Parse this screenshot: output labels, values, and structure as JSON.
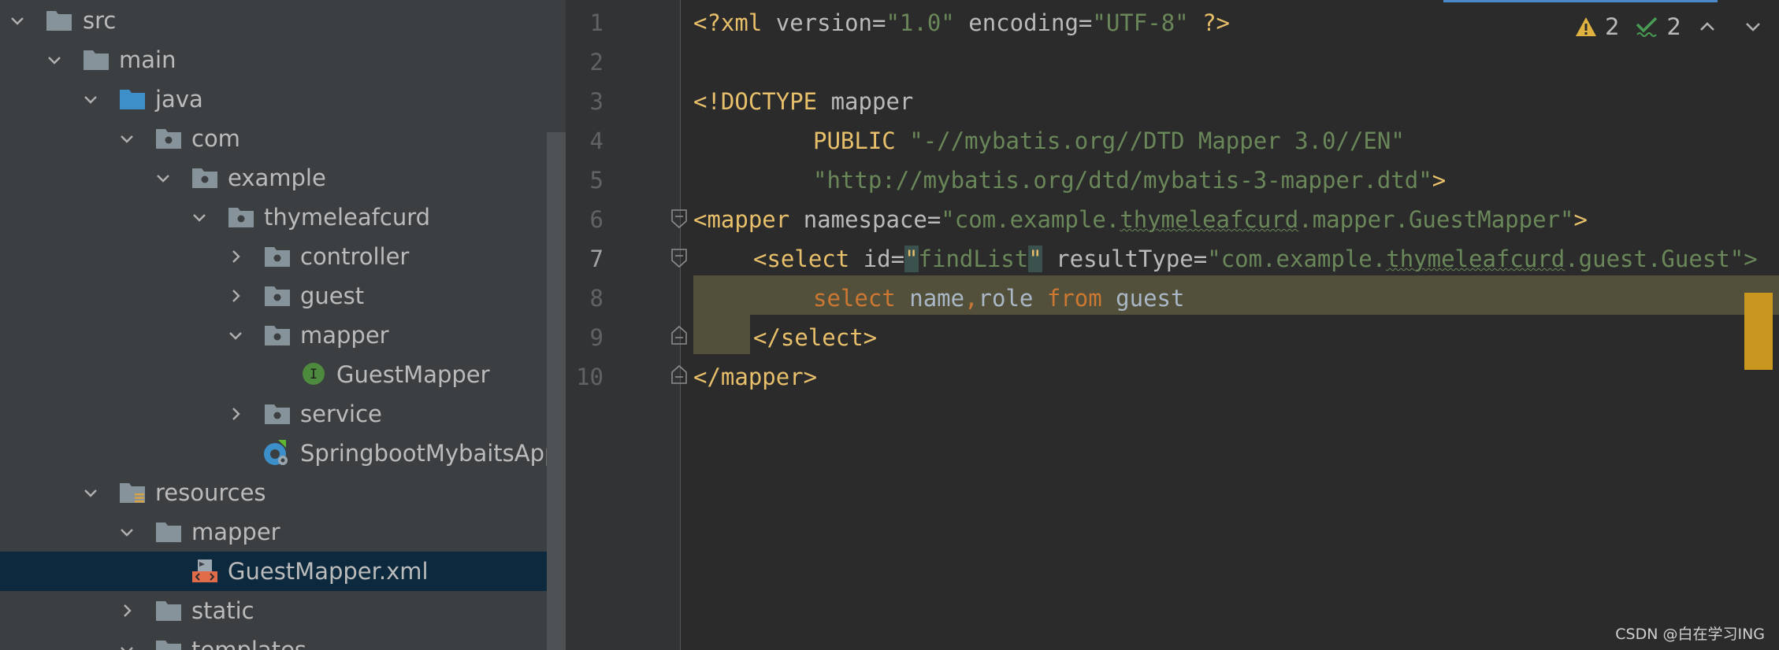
{
  "project_tree": {
    "items": [
      {
        "label": "src",
        "expanded": true
      },
      {
        "label": "main",
        "expanded": true
      },
      {
        "label": "java",
        "expanded": true
      },
      {
        "label": "com",
        "expanded": true
      },
      {
        "label": "example",
        "expanded": true
      },
      {
        "label": "thymeleafcurd",
        "expanded": true
      },
      {
        "label": "controller",
        "expanded": false
      },
      {
        "label": "guest",
        "expanded": false
      },
      {
        "label": "mapper",
        "expanded": true
      },
      {
        "label": "GuestMapper",
        "icon": "interface-icon",
        "icon_letter": "I"
      },
      {
        "label": "service",
        "expanded": false
      },
      {
        "label": "SpringbootMybaitsApplic",
        "icon": "spring-boot-app-icon"
      },
      {
        "label": "resources",
        "expanded": true
      },
      {
        "label": "mapper",
        "expanded": true
      },
      {
        "label": "GuestMapper.xml",
        "icon": "xml-file-icon",
        "selected": true
      },
      {
        "label": "static",
        "expanded": false
      },
      {
        "label": "templates",
        "expanded": true
      }
    ]
  },
  "editor": {
    "line_numbers": [
      "1",
      "2",
      "3",
      "4",
      "5",
      "6",
      "7",
      "8",
      "9",
      "10"
    ],
    "current_line": "7",
    "code": {
      "l1": {
        "open": "<?xml ",
        "version_attr": "version",
        "eq1": "=",
        "version_val": "\"1.0\"",
        "sp": " ",
        "enc_attr": "encoding",
        "eq2": "=",
        "enc_val": "\"UTF-8\"",
        "close": " ?>"
      },
      "l3": {
        "doctype": "<!DOCTYPE",
        "name": " mapper"
      },
      "l4": {
        "public": "PUBLIC",
        "sp": " ",
        "id": "\"-//mybatis.org//DTD Mapper 3.0//EN\""
      },
      "l5": {
        "dtd": "\"http://mybatis.org/dtd/mybatis-3-mapper.dtd\"",
        "close": ">"
      },
      "l6": {
        "open": "<mapper",
        "sp": " ",
        "attr": "namespace",
        "eq": "=",
        "val_a": "\"com.example.",
        "val_b": "thymeleafcurd",
        "val_c": ".mapper.GuestMapper\"",
        "close": ">"
      },
      "l7": {
        "open": "<select",
        "sp1": " ",
        "id_attr": "id",
        "eq1": "=",
        "q1": "\"",
        "id_val": "findList",
        "q2": "\"",
        "sp2": " ",
        "rt_attr": "resultType",
        "eq2": "=",
        "rt_a": "\"com.example.",
        "rt_b": "thymeleafcurd",
        "rt_c": ".guest.Guest\">"
      },
      "l8": {
        "kw_select": "select",
        "sp1": " ",
        "col1": "name",
        "comma": ",",
        "col2": "role",
        "sp2": " ",
        "kw_from": "from",
        "sp3": " ",
        "table": "guest"
      },
      "l9": {
        "close": "</select>"
      },
      "l10": {
        "close": "</mapper>"
      }
    },
    "inspections": {
      "warnings": "2",
      "weak_warnings": "2"
    }
  },
  "colors": {
    "tag": "#e8bf6a",
    "string": "#6a8759",
    "keyword": "#cc7832",
    "warning": "#e0b341",
    "ok": "#499c54"
  },
  "watermark": "CSDN @白在学习ING"
}
